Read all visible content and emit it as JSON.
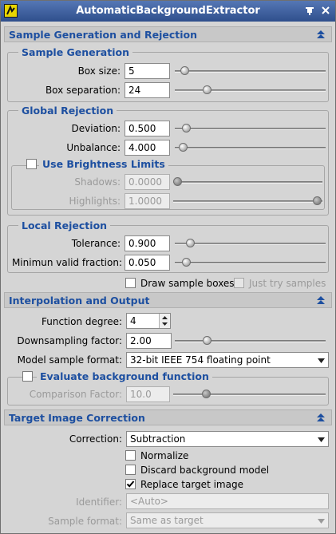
{
  "window": {
    "title": "AutomaticBackgroundExtractor"
  },
  "icons": {
    "app": "abe-app-icon",
    "pin": "pin-icon",
    "close": "close-icon",
    "collapse": "collapse-up-icon"
  },
  "colors": {
    "title_bar": "#3f62a3",
    "section_text": "#1d4fa0",
    "panel_bg": "#d5d5d5"
  },
  "sample_gen_rejection": {
    "header": "Sample Generation and Rejection",
    "sample_generation": {
      "title": "Sample Generation",
      "box_size": {
        "label": "Box size:",
        "value": "5",
        "slider_fraction": 0.04
      },
      "box_separation": {
        "label": "Box separation:",
        "value": "24",
        "slider_fraction": 0.2
      }
    },
    "global_rejection": {
      "title": "Global Rejection",
      "deviation": {
        "label": "Deviation:",
        "value": "0.500",
        "slider_fraction": 0.05
      },
      "unbalance": {
        "label": "Unbalance:",
        "value": "4.000",
        "slider_fraction": 0.03
      },
      "brightness": {
        "label": "Use Brightness Limits",
        "checked": false,
        "shadows": {
          "label": "Shadows:",
          "value": "0.0000",
          "slider_fraction": 0.0
        },
        "highlights": {
          "label": "Highlights:",
          "value": "1.0000",
          "slider_fraction": 1.0
        }
      }
    },
    "local_rejection": {
      "title": "Local Rejection",
      "tolerance": {
        "label": "Tolerance:",
        "value": "0.900",
        "slider_fraction": 0.08
      },
      "min_valid_fraction": {
        "label": "Minimun valid fraction:",
        "value": "0.050",
        "slider_fraction": 0.05
      }
    },
    "draw_sample_boxes": {
      "label": "Draw sample boxes",
      "checked": false
    },
    "just_try_samples": {
      "label": "Just try samples",
      "checked": false
    }
  },
  "interpolation": {
    "header": "Interpolation and Output",
    "function_degree": {
      "label": "Function degree:",
      "value": "4"
    },
    "downsampling": {
      "label": "Downsampling factor:",
      "value": "2.00",
      "slider_fraction": 0.2
    },
    "model_format": {
      "label": "Model sample format:",
      "value": "32-bit IEEE 754 floating point"
    },
    "evaluate": {
      "label": "Evaluate background function",
      "checked": false,
      "comparison_factor": {
        "label": "Comparison Factor:",
        "value": "10.0",
        "slider_fraction": 0.2
      }
    }
  },
  "target": {
    "header": "Target Image Correction",
    "correction": {
      "label": "Correction:",
      "value": "Subtraction"
    },
    "normalize": {
      "label": "Normalize",
      "checked": false
    },
    "discard": {
      "label": "Discard background model",
      "checked": false
    },
    "replace": {
      "label": "Replace target image",
      "checked": true
    },
    "identifier": {
      "label": "Identifier:",
      "placeholder": "<Auto>"
    },
    "sample_format": {
      "label": "Sample format:",
      "value": "Same as target"
    }
  }
}
